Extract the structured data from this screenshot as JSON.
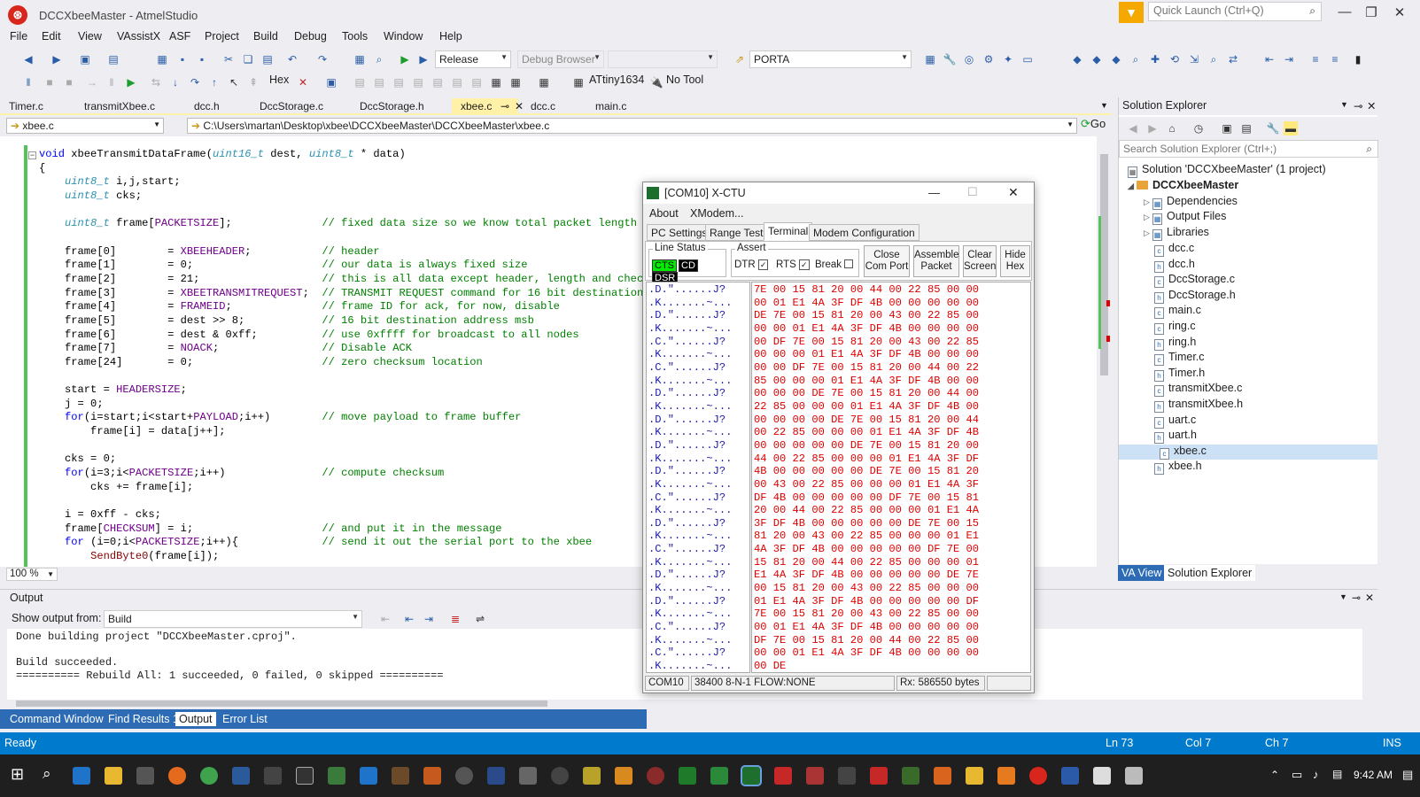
{
  "window": {
    "title": "DCCXbeeMaster - AtmelStudio",
    "quick_launch_placeholder": "Quick Launch (Ctrl+Q)"
  },
  "menu": [
    "File",
    "Edit",
    "View",
    "VAssistX",
    "ASF",
    "Project",
    "Build",
    "Debug",
    "Tools",
    "Window",
    "Help"
  ],
  "toolbar": {
    "configuration": "Release",
    "debug_browser": "Debug Browser",
    "port": "PORTA",
    "hex_label": "Hex",
    "device": "ATtiny1634",
    "tool": "No Tool"
  },
  "doc_tabs": [
    "Timer.c",
    "transmitXbee.c",
    "dcc.h",
    "DccStorage.c",
    "DccStorage.h",
    "xbee.c",
    "dcc.c",
    "main.c"
  ],
  "active_tab": "xbee.c",
  "navbar": {
    "file": "xbee.c",
    "path": "C:\\Users\\martan\\Desktop\\xbee\\DCCXbeeMaster\\DCCXbeeMaster\\xbee.c",
    "go_label": "Go"
  },
  "zoom": "100 %",
  "output": {
    "title": "Output",
    "show_from_label": "Show output from:",
    "source": "Build",
    "lines": [
      "Done building project \"DCCXbeeMaster.cproj\".",
      "",
      "Build succeeded.",
      "========== Rebuild All: 1 succeeded, 0 failed, 0 skipped =========="
    ]
  },
  "bottom_tabs": [
    "Command Window",
    "Find Results 1",
    "Output",
    "Error List"
  ],
  "status": {
    "ready": "Ready",
    "line": "Ln 73",
    "col": "Col 7",
    "ch": "Ch 7",
    "mode": "INS"
  },
  "solution_explorer": {
    "title": "Solution Explorer",
    "search_placeholder": "Search Solution Explorer (Ctrl+;)",
    "solution": "Solution 'DCCXbeeMaster' (1 project)",
    "project": "DCCXbeeMaster",
    "folders": [
      "Dependencies",
      "Output Files",
      "Libraries"
    ],
    "files": [
      "dcc.c",
      "dcc.h",
      "DccStorage.c",
      "DccStorage.h",
      "main.c",
      "ring.c",
      "ring.h",
      "Timer.c",
      "Timer.h",
      "transmitXbee.c",
      "transmitXbee.h",
      "uart.c",
      "uart.h",
      "xbee.c",
      "xbee.h"
    ],
    "selected": "xbee.c",
    "tabs": [
      "VA View",
      "Solution Explorer"
    ]
  },
  "xctu": {
    "title": "[COM10] X-CTU",
    "menu": [
      "About",
      "XModem..."
    ],
    "tabs": [
      "PC Settings",
      "Range Test",
      "Terminal",
      "Modem Configuration"
    ],
    "active_tab": "Terminal",
    "line_status_label": "Line Status",
    "leds": [
      "CTS",
      "CD",
      "DSR"
    ],
    "assert_label": "Assert",
    "asserts": [
      "DTR",
      "RTS",
      "Break"
    ],
    "buttons": [
      "Close Com Port",
      "Assemble Packet",
      "Clear Screen",
      "Hide Hex"
    ],
    "status": {
      "port": "COM10",
      "settings": "38400 8-N-1  FLOW:NONE",
      "rx": "Rx: 586550 bytes"
    }
  },
  "code_lines": [
    "void xbeeTransmitDataFrame(uint16_t dest, uint8_t * data)",
    "{",
    "    uint8_t i,j,start;",
    "    uint8_t cks;",
    "",
    "    uint8_t frame[PACKETSIZE];              // fixed data size so we know total packet length",
    "",
    "    frame[0]        = XBEEHEADER;           // header",
    "    frame[1]        = 0;                    // our data is always fixed size",
    "    frame[2]        = 21;                   // this is all data except header, length and checksum",
    "    frame[3]        = XBEETRANSMITREQUEST;  // TRANSMIT REQUEST command for 16 bit destination addre",
    "    frame[4]        = FRAMEID;              // frame ID for ack, for now, disable",
    "    frame[5]        = dest >> 8;            // 16 bit destination address msb",
    "    frame[6]        = dest & 0xff;          // use 0xffff for broadcast to all nodes",
    "    frame[7]        = NOACK;                // Disable ACK",
    "    frame[24]       = 0;                    // zero checksum location",
    "",
    "    start = HEADERSIZE;",
    "    j = 0;",
    "    for(i=start;i<start+PAYLOAD;i++)        // move payload to frame buffer",
    "        frame[i] = data[j++];",
    "",
    "    cks = 0;",
    "    for(i=3;i<PACKETSIZE;i++)               // compute checksum",
    "        cks += frame[i];",
    "",
    "    i = 0xff - cks;",
    "    frame[CHECKSUM] = i;                    // and put it in the message",
    "    for (i=0;i<PACKETSIZE;i++){             // send it out the serial port to the xbee",
    "        SendByte0(frame[i]);"
  ],
  "terminal_ascii": [
    ".D.\"......J?",
    ".K.......~...",
    ".D.\"......J?",
    ".K.......~...",
    ".C.\"......J?",
    ".K.......~...",
    ".C.\"......J?",
    ".K.......~...",
    ".D.\"......J?",
    ".K.......~...",
    ".D.\"......J?",
    ".K.......~...",
    ".D.\"......J?",
    ".K.......~...",
    ".D.\"......J?",
    ".K.......~...",
    ".C.\"......J?",
    ".K.......~...",
    ".D.\"......J?",
    ".K.......~...",
    ".C.\"......J?",
    ".K.......~...",
    ".D.\"......J?",
    ".K.......~...",
    ".D.\"......J?",
    ".K.......~...",
    ".C.\"......J?",
    ".K.......~...",
    ".C.\"......J?",
    ".K.......~...",
    ".D.\"......J?",
    ".K......"
  ],
  "terminal_hex": [
    "7E 00 15 81 20 00 44 00 22 85 00 00",
    "00 01 E1 4A 3F DF 4B 00 00 00 00 00",
    "DE 7E 00 15 81 20 00 43 00 22 85 00",
    "00 00 01 E1 4A 3F DF 4B 00 00 00 00",
    "00 DF 7E 00 15 81 20 00 43 00 22 85",
    "00 00 00 01 E1 4A 3F DF 4B 00 00 00",
    "00 00 DF 7E 00 15 81 20 00 44 00 22",
    "85 00 00 00 01 E1 4A 3F DF 4B 00 00",
    "00 00 00 DE 7E 00 15 81 20 00 44 00",
    "22 85 00 00 00 01 E1 4A 3F DF 4B 00",
    "00 00 00 00 DE 7E 00 15 81 20 00 44",
    "00 22 85 00 00 00 01 E1 4A 3F DF 4B",
    "00 00 00 00 00 DE 7E 00 15 81 20 00",
    "44 00 22 85 00 00 00 01 E1 4A 3F DF",
    "4B 00 00 00 00 00 DE 7E 00 15 81 20",
    "00 43 00 22 85 00 00 00 01 E1 4A 3F",
    "DF 4B 00 00 00 00 00 DF 7E 00 15 81",
    "20 00 44 00 22 85 00 00 00 01 E1 4A",
    "3F DF 4B 00 00 00 00 00 DE 7E 00 15",
    "81 20 00 43 00 22 85 00 00 00 01 E1",
    "4A 3F DF 4B 00 00 00 00 00 DF 7E 00",
    "15 81 20 00 44 00 22 85 00 00 00 01",
    "E1 4A 3F DF 4B 00 00 00 00 00 DE 7E",
    "00 15 81 20 00 43 00 22 85 00 00 00",
    "01 E1 4A 3F DF 4B 00 00 00 00 00 DF",
    "7E 00 15 81 20 00 43 00 22 85 00 00",
    "00 01 E1 4A 3F DF 4B 00 00 00 00 00",
    "DF 7E 00 15 81 20 00 44 00 22 85 00",
    "00 00 01 E1 4A 3F DF 4B 00 00 00 00",
    "00 DE"
  ]
}
